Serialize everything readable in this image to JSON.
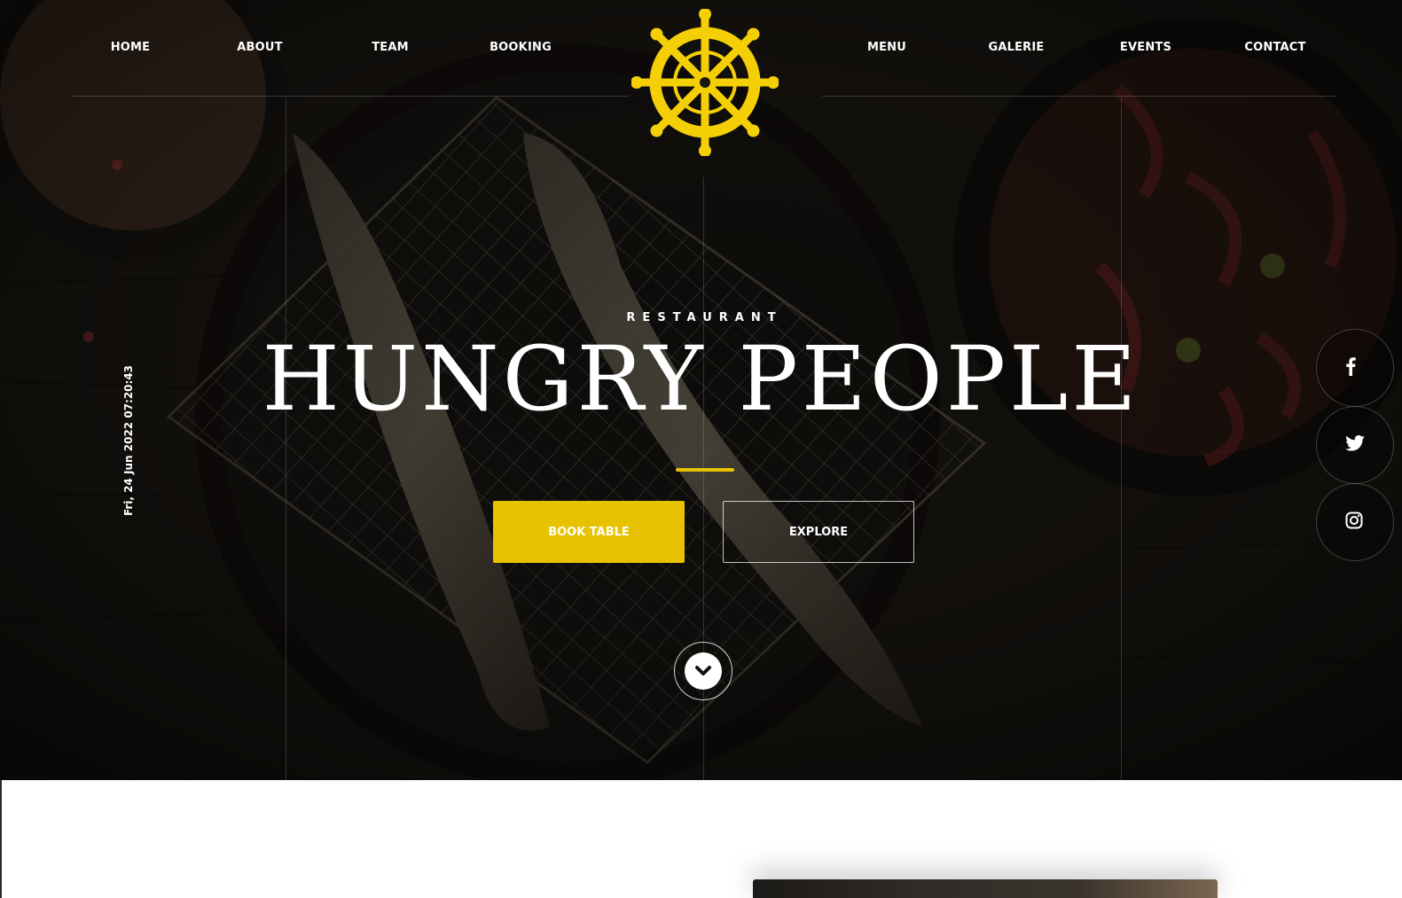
{
  "nav": {
    "left": [
      "HOME",
      "ABOUT",
      "TEAM",
      "BOOKING"
    ],
    "right": [
      "MENU",
      "GALERIE",
      "EVENTS",
      "CONTACT"
    ]
  },
  "logo": {
    "icon": "ship-wheel-icon",
    "color": "#f5cf05"
  },
  "hero": {
    "tagline": "RESTAURANT",
    "title": "HUNGRY PEOPLE",
    "datetime": "Fri, 24 Jun 2022 07:20:43",
    "accent_color": "#e6c200"
  },
  "buttons": {
    "book": "BOOK TABLE",
    "explore": "EXPLORE"
  },
  "social": [
    "facebook-icon",
    "twitter-icon",
    "instagram-icon"
  ]
}
